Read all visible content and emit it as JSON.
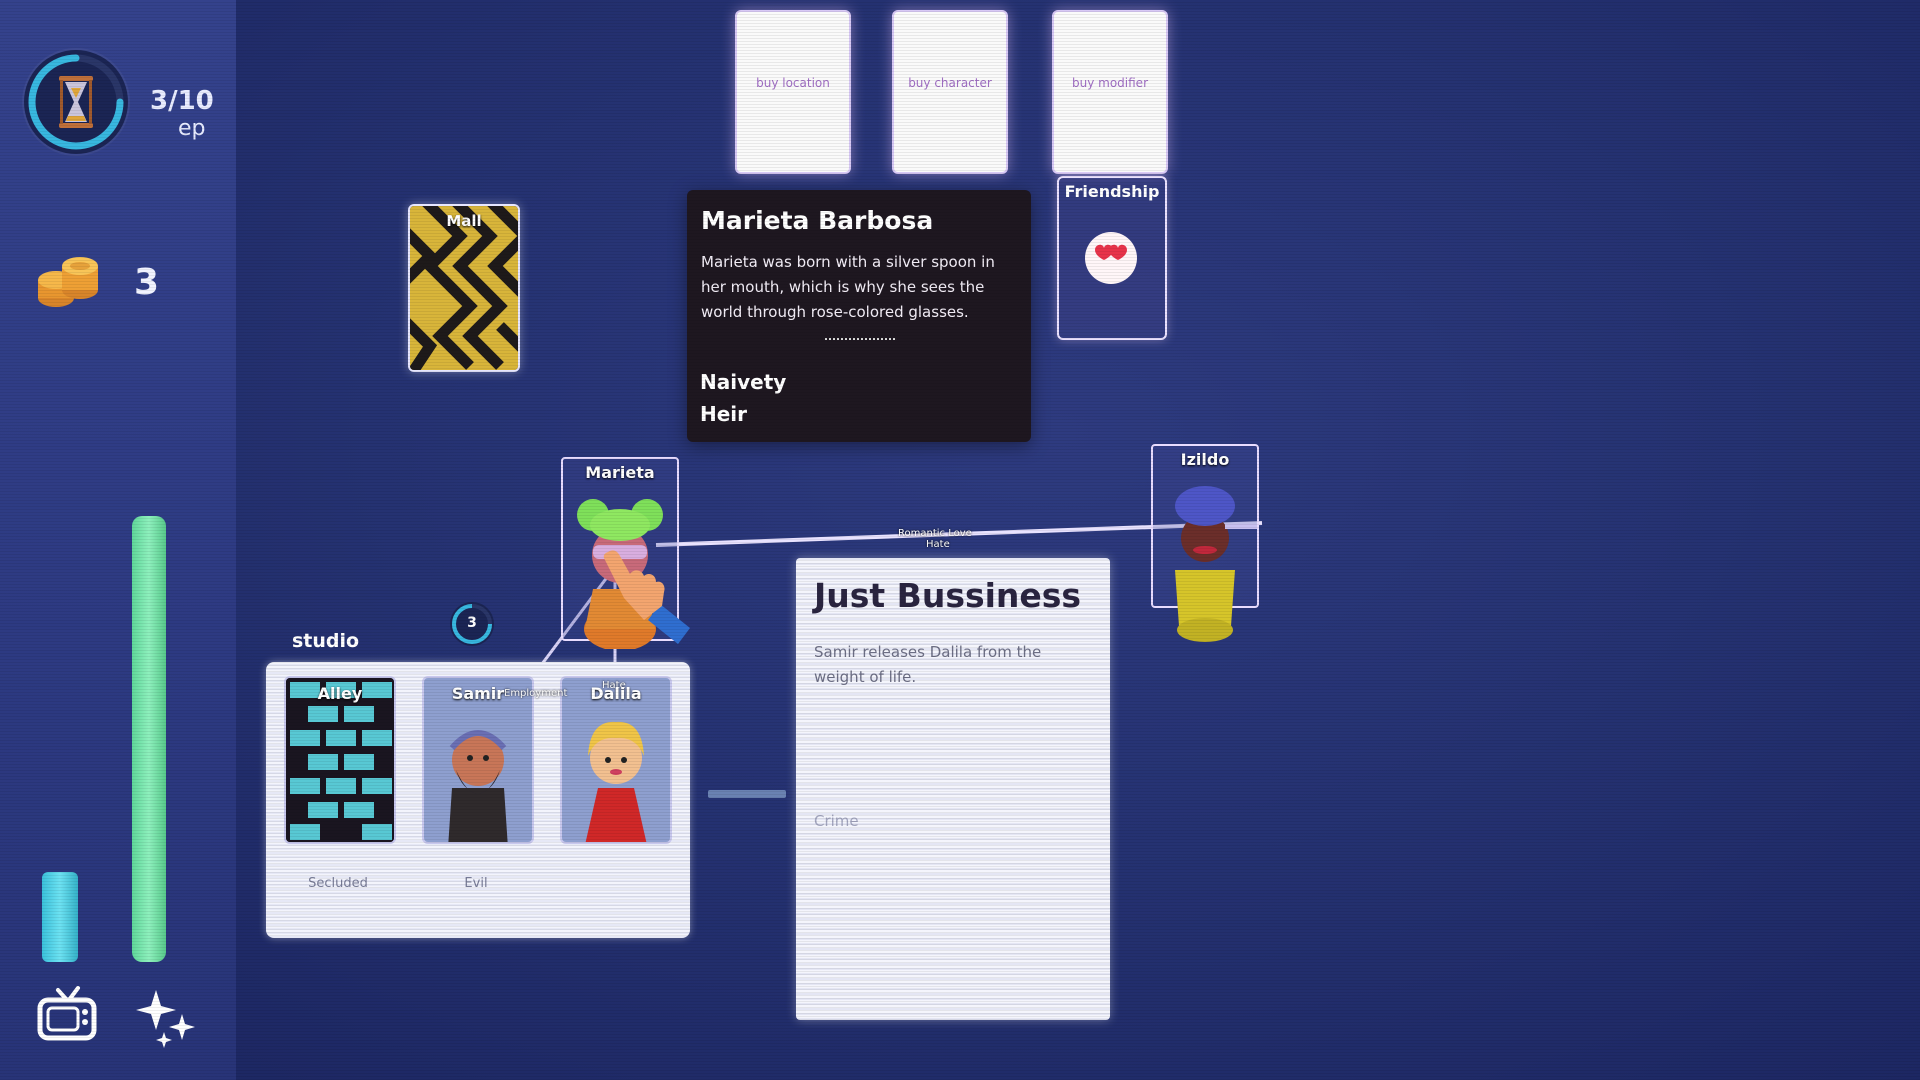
{
  "hud": {
    "episode_count": "3/10",
    "episode_unit": "ep",
    "coins": "3"
  },
  "shop": {
    "buy_location": "buy location",
    "buy_character": "buy character",
    "buy_modifier": "buy modifier"
  },
  "location_card": {
    "label": "Mall"
  },
  "info_card": {
    "name": "Marieta Barbosa",
    "description": "Marieta was born with a silver spoon in her mouth, which is why she sees the world through rose-colored glasses.",
    "traits": [
      "Naivety",
      "Heir"
    ]
  },
  "modifier_card": {
    "label": "Friendship"
  },
  "board": {
    "marieta": "Marieta",
    "izildo": "Izildo",
    "relation_top_1": "Romantic Love",
    "relation_top_2": "Hate",
    "counter": "3"
  },
  "studio": {
    "label": "studio",
    "slots": [
      {
        "name": "Alley",
        "tag": "Secluded"
      },
      {
        "name": "Samir",
        "tag": "Evil"
      },
      {
        "name": "Dalila",
        "tag": ""
      }
    ],
    "relation_small_1": "Employment",
    "relation_small_2": "Hate"
  },
  "event_card": {
    "title": "Just Bussiness",
    "description": "Samir releases Dalila from the weight of life.",
    "tag": "Crime"
  },
  "colors": {
    "background": "#253272",
    "sidebar": "#2d3a82",
    "timer_ring": "#38b8e0",
    "green_bar": "#7be3aa",
    "cyan_bar": "#4fd0e6",
    "info_card_bg": "#1e1720"
  },
  "icons": [
    "hourglass-icon",
    "coins-icon",
    "tv-icon",
    "sparkle-icon",
    "heart-eyes-icon"
  ]
}
